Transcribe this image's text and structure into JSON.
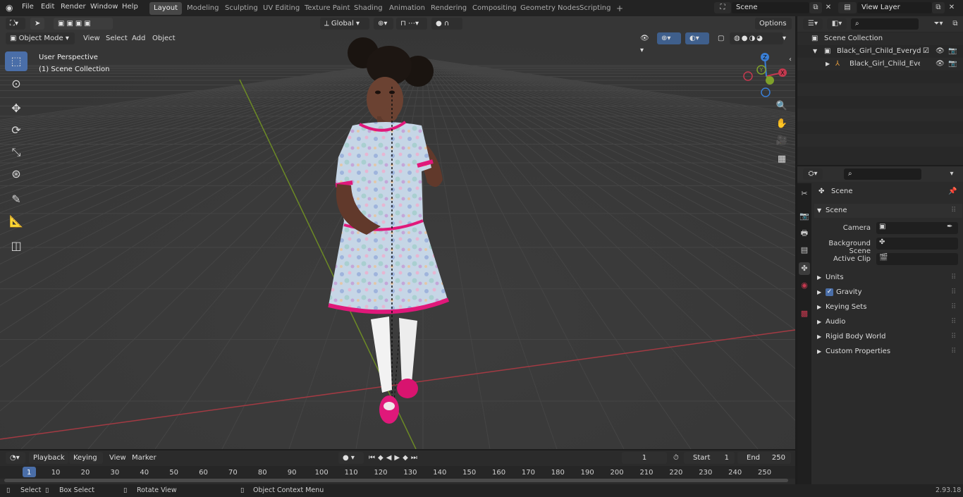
{
  "topbar": {
    "menus": [
      "File",
      "Edit",
      "Render",
      "Window",
      "Help"
    ],
    "workspaces": [
      "Layout",
      "Modeling",
      "Sculpting",
      "UV Editing",
      "Texture Paint",
      "Shading",
      "Animation",
      "Rendering",
      "Compositing",
      "Geometry Nodes",
      "Scripting"
    ],
    "active_workspace": "Layout",
    "add_workspace": "+",
    "scene_name": "Scene",
    "view_layer": "View Layer"
  },
  "viewport": {
    "mode": "Object Mode",
    "menus": [
      "View",
      "Select",
      "Add",
      "Object"
    ],
    "transform_orientation": "Global",
    "options_label": "Options",
    "perspective_label": "User Perspective",
    "collection_label": "(1) Scene Collection",
    "gizmo_axes": [
      "X",
      "Y",
      "Z"
    ],
    "tools": [
      "select-box",
      "cursor",
      "move",
      "rotate",
      "scale",
      "transform",
      "annotate",
      "measure",
      "add-cube"
    ]
  },
  "outliner": {
    "root": "Scene Collection",
    "items": [
      {
        "label": "Black_Girl_Child_Everyday_St"
      },
      {
        "label": "Black_Girl_Child_Everyda"
      }
    ]
  },
  "properties": {
    "context": "Scene",
    "panel_title": "Scene",
    "fields": [
      {
        "label": "Camera"
      },
      {
        "label": "Background Scene"
      },
      {
        "label": "Active Clip"
      }
    ],
    "sections": [
      "Units",
      "Gravity",
      "Keying Sets",
      "Audio",
      "Rigid Body World",
      "Custom Properties"
    ],
    "gravity_checked": true
  },
  "timeline": {
    "menus": [
      "Playback",
      "Keying",
      "View",
      "Marker"
    ],
    "current_frame": "1",
    "start_label": "Start",
    "start_value": "1",
    "end_label": "End",
    "end_value": "250",
    "ticks": [
      "1",
      "10",
      "20",
      "30",
      "40",
      "50",
      "60",
      "70",
      "80",
      "90",
      "100",
      "110",
      "120",
      "130",
      "140",
      "150",
      "160",
      "170",
      "180",
      "190",
      "200",
      "210",
      "220",
      "230",
      "240",
      "250"
    ]
  },
  "statusbar": {
    "select": "Select",
    "box_select": "Box Select",
    "rotate_view": "Rotate View",
    "context_menu": "Object Context Menu",
    "version": "2.93.18"
  },
  "colors": {
    "accent": "#4a6ea8",
    "viewport_bg": "#393939",
    "axis_x": "#c4394f",
    "axis_y": "#7fa12a",
    "axis_z": "#3a7fd6",
    "dress_pink": "#e0187a"
  }
}
